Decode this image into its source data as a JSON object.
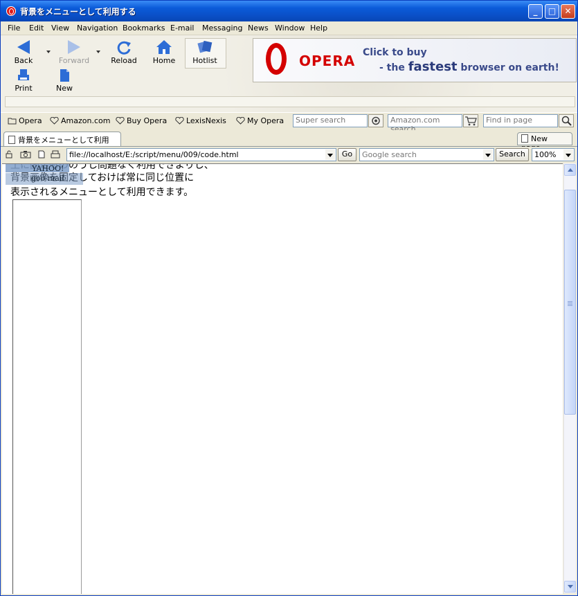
{
  "window": {
    "title": "背景をメニューとして利用する"
  },
  "menubar": [
    "File",
    "Edit",
    "View",
    "Navigation",
    "Bookmarks",
    "E-mail",
    "Messaging",
    "News",
    "Window",
    "Help"
  ],
  "toolbar": {
    "back": "Back",
    "forward": "Forward",
    "reload": "Reload",
    "home": "Home",
    "hotlist": "Hotlist",
    "print": "Print",
    "new": "New"
  },
  "banner": {
    "brand": "OPERA",
    "line1": "Click to buy",
    "line2_prefix": "- the ",
    "line2_big": "fastest",
    "line2_suffix": " browser on earth!"
  },
  "personalbar": {
    "items": [
      "Opera",
      "Amazon.com",
      "Buy Opera",
      "LexisNexis",
      "My Opera"
    ],
    "super_search_placeholder": "Super search",
    "amazon_search_placeholder": "Amazon.com search",
    "find_placeholder": "Find in page"
  },
  "tabs": {
    "active": "背景をメニューとして利用する",
    "new_page": "New page"
  },
  "address": {
    "url": "file://localhost/E:/script/menu/009/code.html",
    "go": "Go",
    "google_placeholder": "Google search",
    "search_button": "Search",
    "zoom": "100%"
  },
  "content": {
    "line0": "土に固定もののうし問題なく利用できよりし、",
    "line1": "背景画像を固定しておけば常に同じ位置に",
    "line2": "表示されるメニューとして利用できます。",
    "overlay1": "YAHOO!",
    "overlay2": "goo mail"
  },
  "colors": {
    "titlebar": "#0a50c8",
    "banner_brand": "#d40000",
    "overlay": "#7f9fc9"
  }
}
